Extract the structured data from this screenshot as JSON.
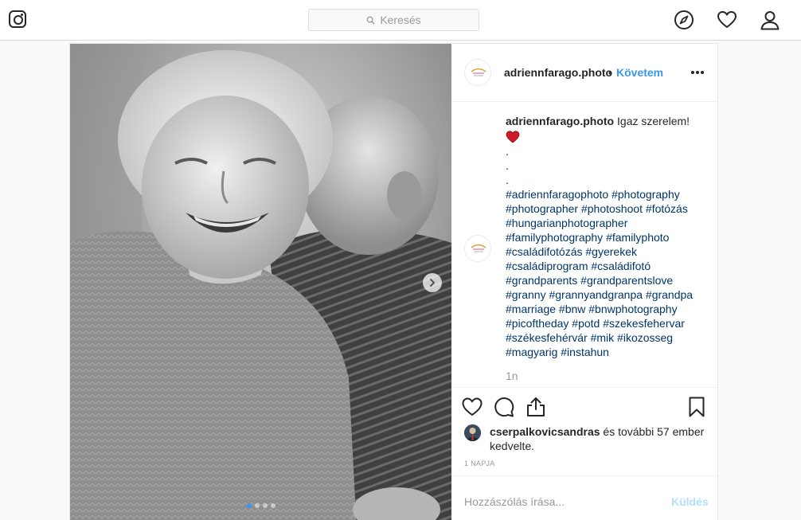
{
  "nav": {
    "search_placeholder": "Keresés",
    "icons": [
      "instagram-logo-icon",
      "search-icon",
      "compass-icon",
      "heart-icon",
      "user-icon"
    ]
  },
  "post": {
    "username": "adriennfarago.photo",
    "separator": "•",
    "follow_label": "Követem",
    "caption": {
      "username": "adriennfarago.photo",
      "text": "Igaz szerelem!",
      "emoji": "red-heart",
      "dots": [
        ".",
        ".",
        "."
      ],
      "hashtag_lines": [
        "#adriennfaragophoto #photography",
        "#photographer #photoshoot #fotózás",
        "#hungarianphotographer",
        "#familyphotography #familyphoto",
        "#családifotózás #gyerekek",
        "#családiprogram #családifotó",
        "#grandparents #grandparentslove",
        "#granny #grannyandgranpa #grandpa",
        "#marriage #bnw #bnwphotography",
        "#picoftheday #potd #szekesfehervar",
        "#székesfehérvár #mik #ikozosseg",
        "#magyarig #instahun"
      ]
    },
    "time_ago": "1n",
    "likes": {
      "user": "cserpalkovicsandras",
      "rest": "és további 57 ember kedvelte."
    },
    "date": "1 NAPJA",
    "comment_placeholder": "Hozzászólás írása...",
    "send_label": "Küldés",
    "carousel": {
      "slides": 4,
      "active": 1
    },
    "colors": {
      "accent": "#3897f0",
      "send_disabled": "#b2dffc",
      "like_heart": "#ed4956"
    }
  }
}
